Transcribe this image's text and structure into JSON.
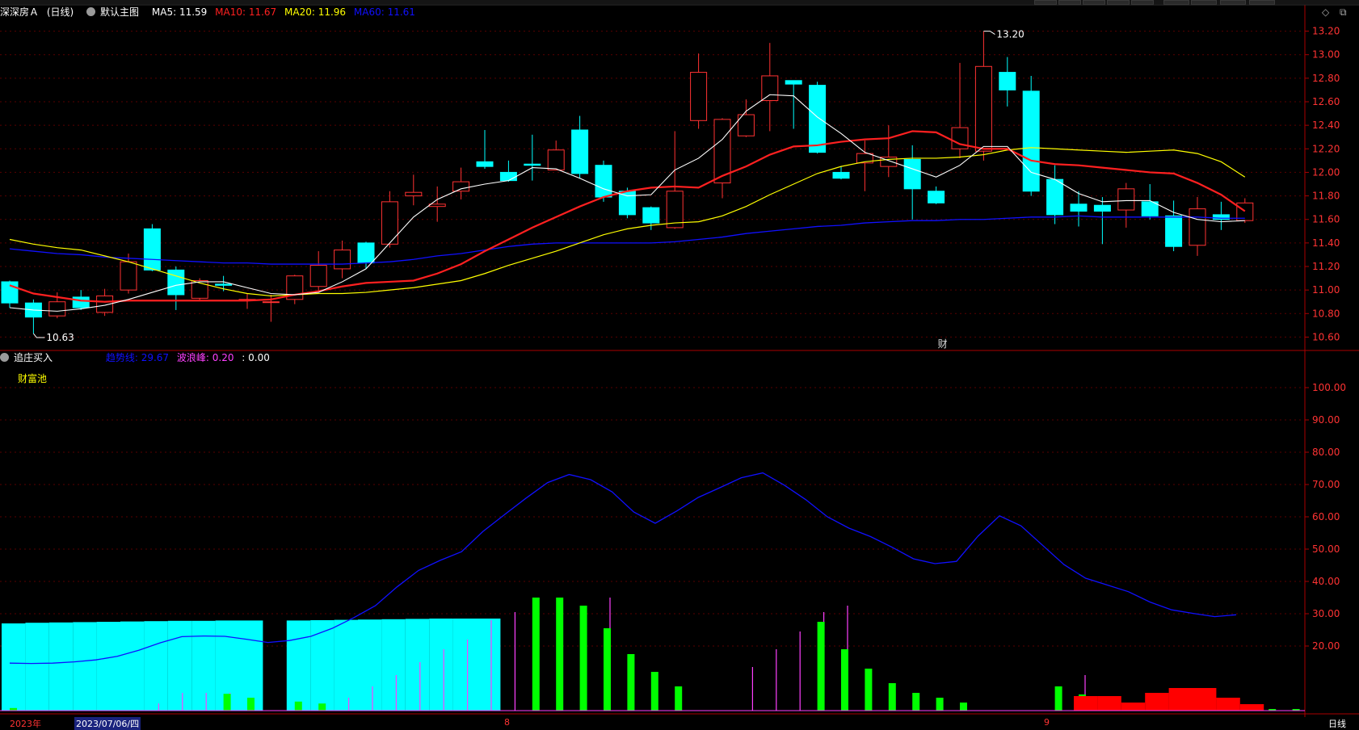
{
  "stock": {
    "name": "深深房Ａ",
    "period": "(日线)"
  },
  "price_header": {
    "main_label": "默认主图",
    "ma5": {
      "label": "MA5: 11.59",
      "color": "#ffffff"
    },
    "ma10": {
      "label": "MA10: 11.67",
      "color": "#ff2020"
    },
    "ma20": {
      "label": "MA20: 11.96",
      "color": "#ffff00"
    },
    "ma60": {
      "label": "MA60: 11.61",
      "color": "#1010ff"
    }
  },
  "indicator_header": {
    "name": "追庄买入",
    "line1": {
      "label": "趋势线: 29.67",
      "color": "#1010ff"
    },
    "line2": {
      "label": "波浪峰: 0.20",
      "color": "#ff40ff"
    },
    "line3": {
      "label": ": 0.00",
      "color": "#ffffff"
    },
    "sub_label": "财富池"
  },
  "annotations": {
    "high_label": "13.20",
    "low_label": "10.63",
    "marker_char": "财"
  },
  "bottom_bar": {
    "year": "2023年",
    "selected_date": "2023/07/06/四",
    "period": "日线",
    "month_ticks": [
      "8",
      "9"
    ]
  },
  "colors": {
    "up": "#ff3232",
    "down": "#00ffff",
    "ma5": "#ffffff",
    "ma10": "#ff2020",
    "ma20": "#ffff00",
    "ma60": "#1010ff",
    "trend": "#1010ff",
    "wave": "#ff40ff",
    "green_bar": "#00ff00",
    "red_bar": "#ff0000",
    "axis": "#aa0000"
  },
  "chart_data": [
    {
      "type": "candlestick",
      "y_ticks": [
        10.6,
        10.8,
        11.0,
        11.2,
        11.4,
        11.6,
        11.8,
        12.0,
        12.2,
        12.4,
        12.6,
        12.8,
        13.0,
        13.2
      ],
      "y_tick_labels": [
        "10.60",
        "10.80",
        "11.00",
        "11.20",
        "11.40",
        "11.60",
        "11.80",
        "12.00",
        "12.20",
        "12.40",
        "12.60",
        "12.80",
        "13.00",
        "13.20"
      ],
      "ylim": [
        10.5,
        13.3
      ],
      "candles": [
        [
          11.07,
          10.89,
          11.08,
          10.85
        ],
        [
          10.89,
          10.77,
          10.92,
          10.63
        ],
        [
          10.78,
          10.9,
          10.98,
          10.76
        ],
        [
          10.94,
          10.85,
          11.0,
          10.83
        ],
        [
          10.81,
          10.95,
          11.01,
          10.78
        ],
        [
          11.0,
          11.24,
          11.31,
          10.97
        ],
        [
          11.52,
          11.17,
          11.56,
          11.16
        ],
        [
          11.17,
          10.96,
          11.2,
          10.83
        ],
        [
          10.93,
          11.08,
          11.1,
          10.91
        ],
        [
          11.05,
          11.04,
          11.12,
          10.99
        ],
        [
          10.92,
          10.92,
          10.97,
          10.84
        ],
        [
          10.9,
          10.9,
          10.96,
          10.73
        ],
        [
          10.92,
          11.12,
          11.13,
          10.88
        ],
        [
          11.03,
          11.21,
          11.33,
          10.98
        ],
        [
          11.18,
          11.34,
          11.42,
          11.1
        ],
        [
          11.4,
          11.23,
          11.41,
          11.18
        ],
        [
          11.39,
          11.75,
          11.84,
          11.36
        ],
        [
          11.8,
          11.83,
          11.98,
          11.72
        ],
        [
          11.71,
          11.73,
          11.88,
          11.58
        ],
        [
          11.84,
          11.92,
          12.04,
          11.77
        ],
        [
          12.09,
          12.05,
          12.36,
          12.03
        ],
        [
          12.0,
          11.93,
          12.1,
          11.92
        ],
        [
          12.07,
          12.06,
          12.32,
          11.93
        ],
        [
          12.02,
          12.19,
          12.27,
          12.03
        ],
        [
          12.36,
          11.99,
          12.48,
          11.95
        ],
        [
          12.06,
          11.79,
          12.1,
          11.75
        ],
        [
          11.84,
          11.64,
          11.87,
          11.61
        ],
        [
          11.7,
          11.57,
          11.71,
          11.51
        ],
        [
          11.53,
          11.84,
          12.35,
          11.52
        ],
        [
          12.44,
          12.85,
          13.01,
          12.37
        ],
        [
          11.91,
          12.45,
          12.46,
          11.78
        ],
        [
          12.31,
          12.49,
          12.62,
          12.3
        ],
        [
          12.61,
          12.82,
          13.1,
          12.35
        ],
        [
          12.78,
          12.75,
          12.78,
          12.37
        ],
        [
          12.74,
          12.17,
          12.77,
          12.16
        ],
        [
          12.0,
          11.95,
          12.05,
          11.94
        ],
        [
          12.08,
          12.16,
          12.27,
          11.84
        ],
        [
          12.05,
          12.13,
          12.4,
          11.96
        ],
        [
          12.11,
          11.86,
          12.23,
          11.6
        ],
        [
          11.84,
          11.74,
          11.88,
          11.73
        ],
        [
          12.2,
          12.38,
          12.93,
          12.12
        ],
        [
          12.18,
          12.9,
          13.2,
          12.1
        ],
        [
          12.85,
          12.7,
          12.98,
          12.56
        ],
        [
          12.69,
          11.84,
          12.82,
          11.8
        ],
        [
          11.94,
          11.64,
          12.06,
          11.56
        ],
        [
          11.73,
          11.67,
          11.84,
          11.54
        ],
        [
          11.72,
          11.67,
          11.79,
          11.39
        ],
        [
          11.68,
          11.86,
          11.91,
          11.53
        ],
        [
          11.75,
          11.63,
          11.9,
          11.6
        ],
        [
          11.63,
          11.37,
          11.76,
          11.33
        ],
        [
          11.38,
          11.69,
          11.79,
          11.29
        ],
        [
          11.64,
          11.6,
          11.75,
          11.51
        ],
        [
          11.59,
          11.74,
          11.78,
          11.57
        ]
      ],
      "ma5": [
        10.85,
        10.83,
        10.82,
        10.84,
        10.87,
        10.92,
        10.98,
        11.04,
        11.07,
        11.07,
        11.02,
        10.97,
        10.96,
        10.98,
        11.07,
        11.18,
        11.4,
        11.62,
        11.77,
        11.86,
        11.9,
        11.93,
        12.04,
        12.03,
        11.95,
        11.86,
        11.8,
        11.81,
        12.02,
        12.12,
        12.28,
        12.52,
        12.66,
        12.65,
        12.47,
        12.33,
        12.17,
        12.1,
        12.03,
        11.96,
        12.06,
        12.22,
        12.22,
        12.0,
        11.94,
        11.82,
        11.75,
        11.76,
        11.76,
        11.66,
        11.6,
        11.58,
        11.59
      ],
      "ma10": [
        11.04,
        10.97,
        10.94,
        10.91,
        10.9,
        10.91,
        10.91,
        10.91,
        10.91,
        10.91,
        10.91,
        10.92,
        10.96,
        10.99,
        11.03,
        11.06,
        11.07,
        11.08,
        11.14,
        11.22,
        11.33,
        11.43,
        11.53,
        11.62,
        11.71,
        11.79,
        11.84,
        11.87,
        11.88,
        11.87,
        11.97,
        12.05,
        12.15,
        12.22,
        12.23,
        12.26,
        12.28,
        12.29,
        12.35,
        12.34,
        12.24,
        12.2,
        12.2,
        12.1,
        12.07,
        12.06,
        12.04,
        12.02,
        12.0,
        11.99,
        11.91,
        11.81,
        11.67
      ],
      "ma20": [
        11.43,
        11.39,
        11.36,
        11.34,
        11.29,
        11.24,
        11.18,
        11.12,
        11.06,
        11.01,
        10.97,
        10.95,
        10.96,
        10.97,
        10.97,
        10.98,
        11.0,
        11.02,
        11.05,
        11.08,
        11.14,
        11.21,
        11.27,
        11.33,
        11.4,
        11.47,
        11.52,
        11.55,
        11.57,
        11.58,
        11.63,
        11.71,
        11.81,
        11.9,
        11.99,
        12.05,
        12.09,
        12.11,
        12.12,
        12.12,
        12.13,
        12.15,
        12.19,
        12.21,
        12.2,
        12.19,
        12.18,
        12.17,
        12.18,
        12.19,
        12.16,
        12.09,
        11.96
      ],
      "ma60": [
        11.35,
        11.33,
        11.31,
        11.3,
        11.28,
        11.27,
        11.26,
        11.25,
        11.24,
        11.23,
        11.23,
        11.22,
        11.22,
        11.22,
        11.22,
        11.23,
        11.24,
        11.26,
        11.29,
        11.31,
        11.34,
        11.37,
        11.39,
        11.4,
        11.4,
        11.4,
        11.4,
        11.4,
        11.41,
        11.43,
        11.45,
        11.48,
        11.5,
        11.52,
        11.54,
        11.55,
        11.57,
        11.58,
        11.59,
        11.59,
        11.6,
        11.6,
        11.61,
        11.62,
        11.62,
        11.63,
        11.62,
        11.62,
        11.62,
        11.62,
        11.62,
        11.61,
        11.61
      ],
      "high_index": 41,
      "low_index": 1
    },
    {
      "type": "bar+line",
      "y_ticks": [
        20,
        30,
        40,
        50,
        60,
        70,
        80,
        90,
        100
      ],
      "y_tick_labels": [
        "20.00",
        "30.00",
        "40.00",
        "50.00",
        "60.00",
        "70.00",
        "80.00",
        "90.00",
        "100.00"
      ],
      "ylim": [
        0,
        107
      ],
      "trend_line": [
        14.7,
        14.6,
        14.7,
        15.1,
        15.7,
        16.8,
        18.7,
        21.0,
        22.9,
        23.1,
        23.0,
        22.1,
        21.1,
        21.7,
        23.0,
        25.5,
        28.8,
        32.5,
        38.3,
        43.4,
        46.5,
        49.2,
        55.5,
        60.7,
        65.8,
        70.6,
        73.1,
        71.5,
        67.7,
        61.5,
        58.0,
        61.8,
        66.0,
        69.0,
        72.1,
        73.6,
        69.8,
        65.3,
        60.0,
        56.5,
        53.9,
        50.6,
        47.0,
        45.5,
        46.2,
        54.0,
        60.3,
        57.2,
        51.2,
        45.2,
        41.0,
        38.9,
        36.8,
        33.6,
        31.2,
        30.1,
        29.1,
        29.67
      ],
      "cyan_block": [
        27.0,
        27.2,
        27.3,
        27.4,
        27.5,
        27.6,
        27.7,
        27.8,
        27.8,
        27.9,
        27.9,
        null,
        27.9,
        28.0,
        28.1,
        28.2,
        28.3,
        28.4,
        28.5,
        28.5,
        28.5
      ],
      "green_bars": [
        0.8,
        0,
        0,
        0,
        0,
        0,
        0,
        0,
        0,
        5.2,
        4.0,
        0,
        2.8,
        2.2,
        0,
        0,
        0,
        0,
        0,
        0,
        0,
        0,
        35.0,
        35.0,
        32.5,
        25.5,
        17.5,
        12.0,
        7.5,
        0,
        0,
        0,
        0,
        0,
        27.5,
        19.0,
        13.0,
        8.5,
        5.5,
        4.0,
        2.5,
        0,
        0,
        0,
        7.5,
        5.0,
        3.8,
        2.5,
        1.5,
        1.0,
        0.8,
        0.6,
        0.5,
        0.5,
        0.5
      ],
      "magenta_bars": [
        0,
        0,
        0,
        0,
        0,
        0,
        2.2,
        5.5,
        5.5,
        5.5,
        0,
        0,
        0,
        0,
        4.0,
        7.5,
        11.0,
        15.0,
        19.0,
        22.0,
        28.0,
        30.5,
        0,
        35.0,
        0,
        35.0,
        0,
        0,
        0,
        0,
        0,
        13.5,
        19.0,
        24.5,
        30.5,
        32.5,
        0,
        0,
        0,
        0,
        0,
        0,
        0,
        0,
        6.0,
        11.0,
        0,
        0,
        0,
        0,
        0,
        0,
        0,
        0,
        0,
        0,
        0
      ],
      "red_bars": [
        0,
        0,
        0,
        0,
        0,
        0,
        0,
        0,
        0,
        0,
        0,
        0,
        0,
        0,
        0,
        0,
        0,
        0,
        0,
        0,
        0,
        0,
        0,
        0,
        0,
        0,
        0,
        0,
        0,
        0,
        0,
        0,
        0,
        0,
        0,
        0,
        0,
        0,
        0,
        0,
        0,
        0,
        0,
        0,
        0,
        4.5,
        4.5,
        2.5,
        5.5,
        7.0,
        7.0,
        4.0,
        2.0,
        0,
        0,
        0,
        0
      ]
    }
  ]
}
